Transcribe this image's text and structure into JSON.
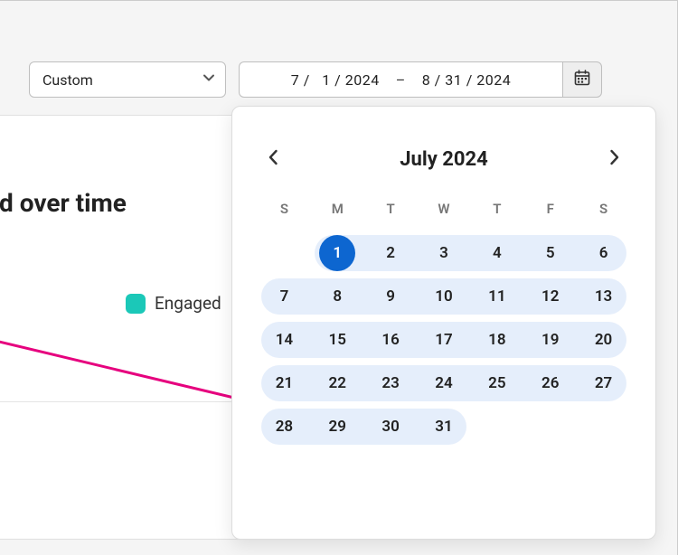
{
  "toolbar": {
    "range_select_label": "Custom",
    "date_range": {
      "start": "7 /   1 / 2024",
      "end": "8 / 31 / 2024",
      "separator": "–"
    }
  },
  "chart": {
    "title_fragment": "d over time",
    "legend": {
      "swatch_color": "#1bc8b8",
      "label": "Engaged"
    },
    "line_color": "#e6007e"
  },
  "calendar": {
    "title": "July 2024",
    "dow": [
      "S",
      "M",
      "T",
      "W",
      "T",
      "F",
      "S"
    ],
    "weeks": [
      {
        "range_start_col": 1,
        "range_end_col": 6,
        "days": [
          "",
          "1",
          "2",
          "3",
          "4",
          "5",
          "6"
        ],
        "selected_index": 1
      },
      {
        "range_start_col": 0,
        "range_end_col": 6,
        "days": [
          "7",
          "8",
          "9",
          "10",
          "11",
          "12",
          "13"
        ]
      },
      {
        "range_start_col": 0,
        "range_end_col": 6,
        "days": [
          "14",
          "15",
          "16",
          "17",
          "18",
          "19",
          "20"
        ]
      },
      {
        "range_start_col": 0,
        "range_end_col": 6,
        "days": [
          "21",
          "22",
          "23",
          "24",
          "25",
          "26",
          "27"
        ]
      },
      {
        "range_start_col": 0,
        "range_end_col": 3,
        "days": [
          "28",
          "29",
          "30",
          "31",
          "",
          "",
          ""
        ]
      }
    ]
  }
}
